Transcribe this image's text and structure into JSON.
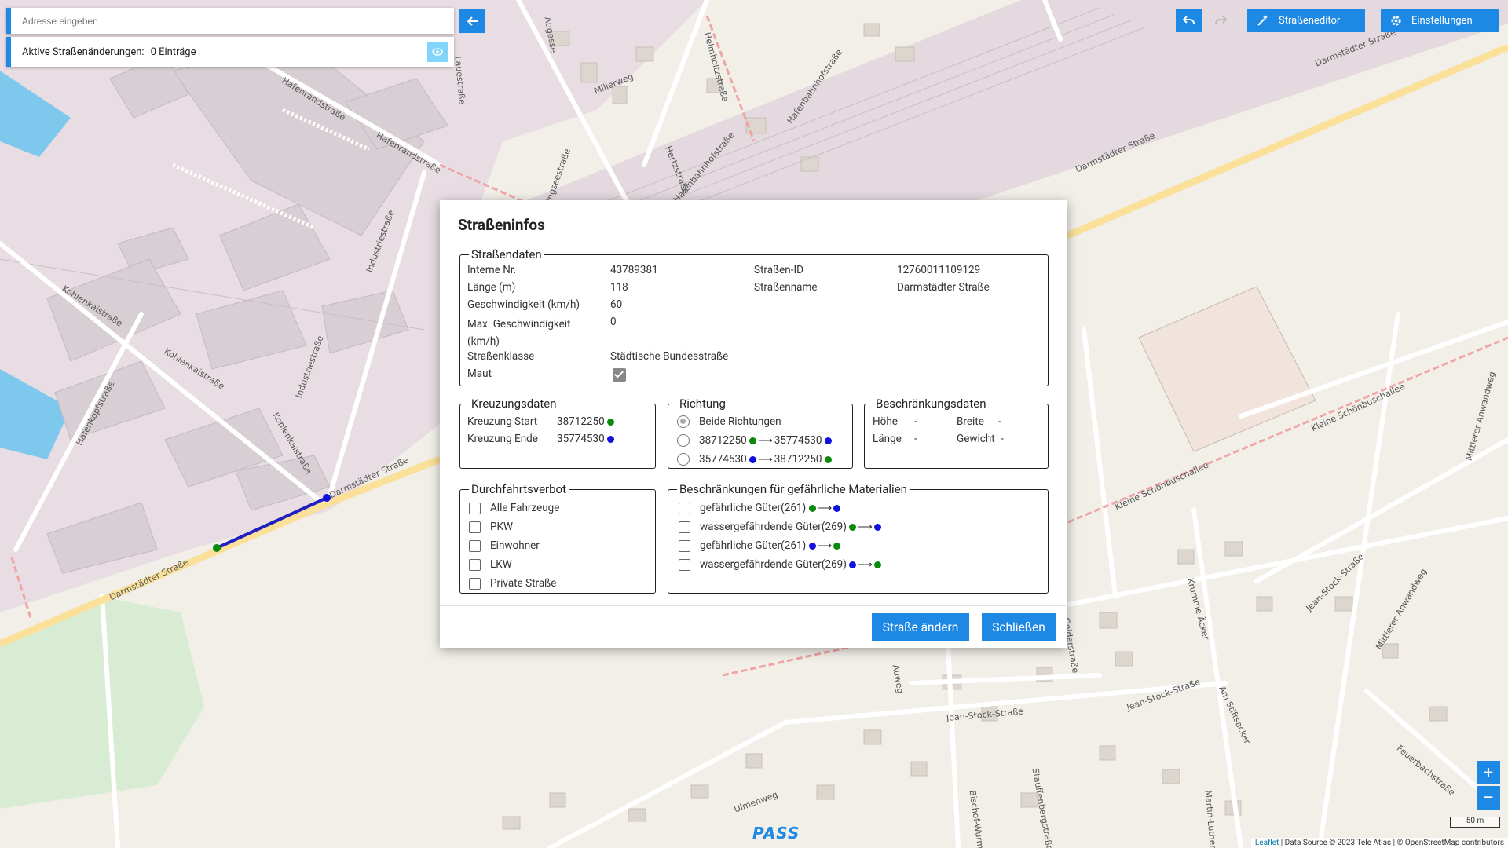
{
  "search": {
    "placeholder": "Adresse eingeben"
  },
  "changes": {
    "label": "Aktive Straßenänderungen:",
    "value": "0 Einträge"
  },
  "toolbar": {
    "street_editor": "Straßeneditor",
    "settings": "Einstellungen"
  },
  "map": {
    "labels": [
      "Hafenrandstraße",
      "Hafenrandstraße",
      "Kohlenkaistraße",
      "Kohlenkaistraße",
      "Hafenkopfstraße",
      "Industriestraße",
      "Industriestraße",
      "Kohlenkaistraße",
      "Darmstädter Straße",
      "Darmstädter Straße",
      "Darmstädter Straße",
      "Darmstädter Straße",
      "Millerweg",
      "Hertzstraße",
      "Hafenbahnhofstraße",
      "Hafenbahnhofstraße",
      "Helmholtzstraße",
      "Augasse",
      "Lauestraße",
      "Klingseestraße",
      "Kleine Schönbuschallee",
      "Kleine Schönbuschallee",
      "Mittlerer Anwandweg",
      "Mittlerer Anwandweg",
      "Krumme Äcker",
      "Jean-Stock-Straße",
      "Jean-Stock-Straße",
      "Jean-Stock-Straße",
      "Am Stiftsacker",
      "Feuerbachstraße",
      "Ulmenweg",
      "Bischof-Wurm-Straße",
      "Stauffenbergstraße",
      "Martin-Luther-Straße",
      "Auweg",
      "Geiderstraße"
    ],
    "scale": "50 m",
    "zoom_in": "+",
    "zoom_out": "–",
    "attribution_link": "Leaflet",
    "attribution_rest": "| Data Source © 2023 Tele Atlas | © OpenStreetMap contributors",
    "logo": "PASS"
  },
  "dialog": {
    "title": "Straßeninfos",
    "strassendaten": {
      "legend": "Straßendaten",
      "interne_nr_label": "Interne Nr.",
      "interne_nr": "43789381",
      "laenge_label": "Länge (m)",
      "laenge": "118",
      "geschw_label": "Geschwindigkeit (km/h)",
      "geschw": "60",
      "maxgeschw_label": "Max. Geschwindigkeit (km/h)",
      "maxgeschw": "0",
      "klasse_label": "Straßenklasse",
      "klasse": "Städtische Bundesstraße",
      "maut_label": "Maut",
      "maut_checked": true,
      "id_label": "Straßen-ID",
      "id": "12760011109129",
      "name_label": "Straßenname",
      "name": "Darmstädter Straße"
    },
    "kreuzung": {
      "legend": "Kreuzungsdaten",
      "start_label": "Kreuzung Start",
      "start": "38712250",
      "ende_label": "Kreuzung Ende",
      "ende": "35774530"
    },
    "richtung": {
      "legend": "Richtung",
      "beide": "Beide Richtungen",
      "opt2_from": "38712250",
      "opt2_to": "35774530",
      "opt3_from": "35774530",
      "opt3_to": "38712250",
      "selected": "Beide Richtungen"
    },
    "beschraenkung": {
      "legend": "Beschränkungsdaten",
      "hoehe_label": "Höhe",
      "hoehe": "-",
      "breite_label": "Breite",
      "breite": "-",
      "laenge_label": "Länge",
      "laenge": "-",
      "gewicht_label": "Gewicht",
      "gewicht": "-"
    },
    "durchfahrt": {
      "legend": "Durchfahrtsverbot",
      "items": [
        "Alle Fahrzeuge",
        "PKW",
        "Einwohner",
        "LKW",
        "Private Straße"
      ]
    },
    "gefahr": {
      "legend": "Beschränkungen für gefährliche Materialien",
      "items": [
        "gefährliche Güter(261)",
        "wassergefährdende Güter(269)",
        "gefährliche Güter(261)",
        "wassergefährdende Güter(269)"
      ]
    },
    "btn_change": "Straße ändern",
    "btn_close": "Schließen"
  },
  "colors": {
    "accent": "#1e88e5",
    "green_dot": "#0a8a0a",
    "blue_dot": "#1010e0"
  }
}
